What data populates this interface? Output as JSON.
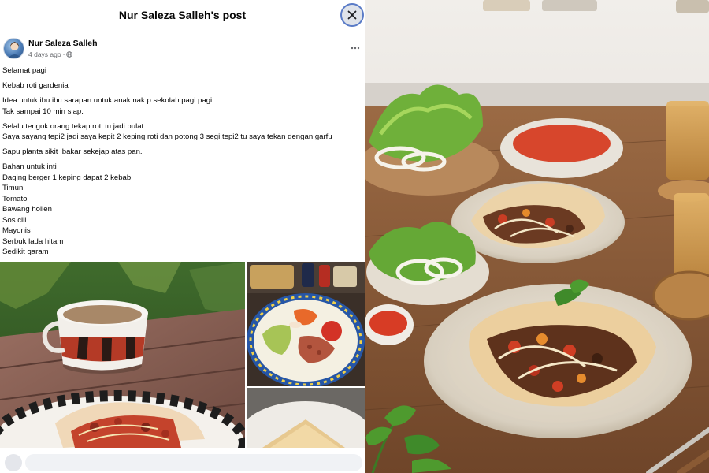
{
  "header": {
    "title": "Nur Saleza Salleh's post",
    "close_icon": "close-icon"
  },
  "post": {
    "author": "Nur Saleza Salleh",
    "time": "4 days ago",
    "separator": "·",
    "audience_icon": "globe-icon",
    "more_icon": "more-horizontal-icon",
    "paragraphs": [
      [
        "Selamat pagi"
      ],
      [
        "Kebab roti gardenia"
      ],
      [
        "Idea untuk ibu ibu sarapan untuk anak nak p sekolah pagi pagi.",
        "Tak sampai 10 min siap."
      ],
      [
        "Selalu tengok orang tekap roti tu jadi bulat.",
        "Saya sayang tepi2 jadi saya kepit 2 keping roti dan potong 3 segi.tepi2 tu saya tekan dengan garfu"
      ],
      [
        "Sapu planta sikit ,bakar sekejap atas pan."
      ],
      [
        "Bahan untuk inti",
        "Daging berger 1 keping dapat 2 kebab",
        "Timun",
        "Tomato",
        "Bawang hollen",
        "Sos cili",
        "Mayonis",
        "Serbuk lada hitam",
        "Sedikit garam"
      ]
    ]
  },
  "photos": {
    "main": "tea-cup-and-kebab-photo",
    "side_1": "ingredients-plate-photo",
    "side_2": "toasted-bread-photo"
  },
  "hero": {
    "image": "kebab-plates-photo"
  }
}
